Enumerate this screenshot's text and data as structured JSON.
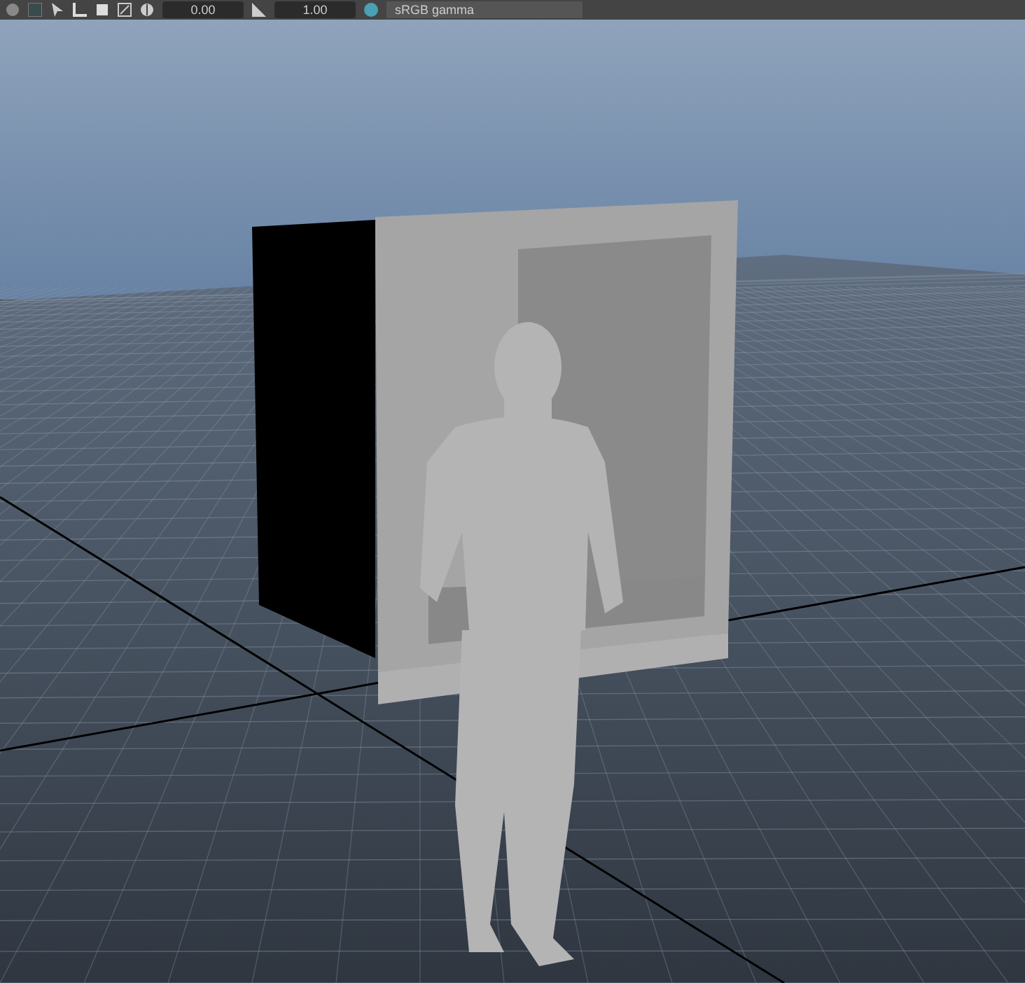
{
  "toolbar": {
    "fields": [
      {
        "value": "0.00"
      },
      {
        "value": "1.00"
      }
    ],
    "color_space": "sRGB gamma"
  }
}
